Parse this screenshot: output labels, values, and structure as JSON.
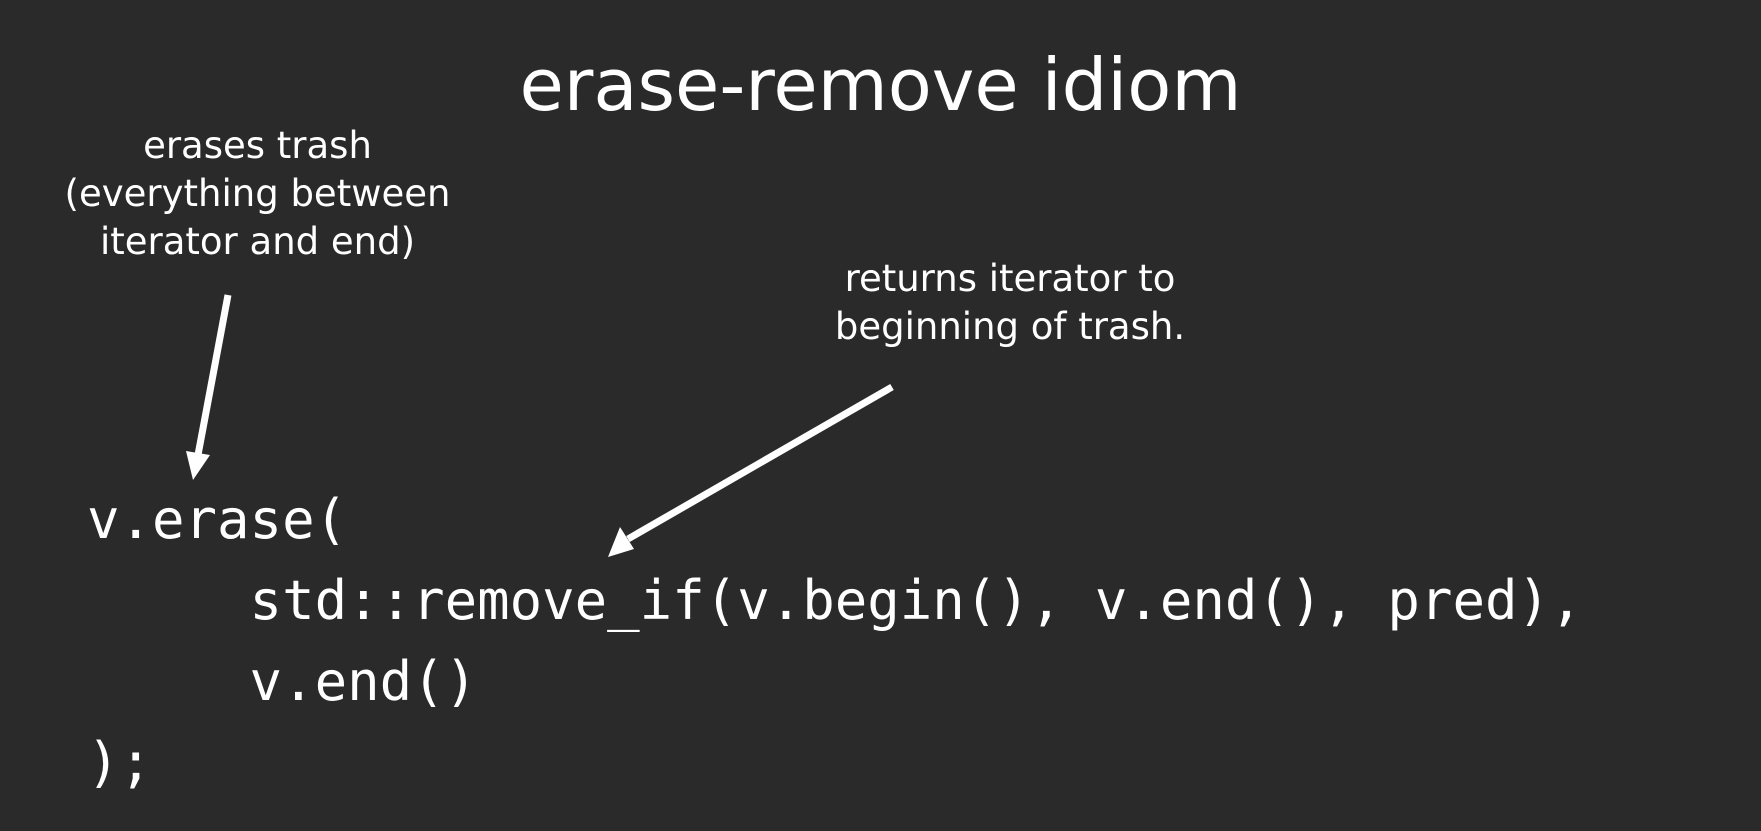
{
  "slide": {
    "title": "erase-remove idiom",
    "annotations": {
      "left": {
        "lines": [
          "erases trash",
          "(everything between",
          "iterator and end)"
        ]
      },
      "right": {
        "lines": [
          "returns iterator to",
          "beginning of trash."
        ]
      }
    },
    "code_lines": [
      "v.erase(",
      "     std::remove_if(v.begin(), v.end(), pred),",
      "     v.end()",
      ");"
    ],
    "colors": {
      "background": "#2a2a2a",
      "text": "#ffffff",
      "arrow": "#ffffff"
    }
  }
}
